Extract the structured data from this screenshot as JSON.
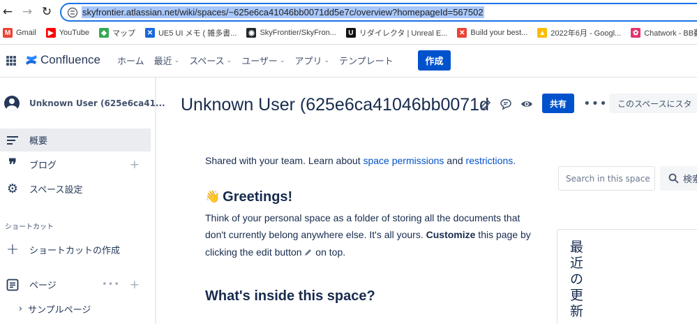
{
  "browser": {
    "url": "skyfrontier.atlassian.net/wiki/spaces/~625e6ca41046bb0071dd5e7c/overview?homepageId=567502",
    "bookmarks": [
      {
        "label": "Gmail",
        "icon": "gmail-icon",
        "color": "#ea4335",
        "glyph": "M"
      },
      {
        "label": "YouTube",
        "icon": "youtube-icon",
        "color": "#ff0000",
        "glyph": "▶"
      },
      {
        "label": "マップ",
        "icon": "maps-icon",
        "color": "#34a853",
        "glyph": "◆"
      },
      {
        "label": "UE5 UI メモ ( 雑多書...",
        "icon": "confluence-bookmark-icon",
        "color": "#1868db",
        "glyph": "✕"
      },
      {
        "label": "SkyFrontier/SkyFron...",
        "icon": "github-icon",
        "color": "#24292e",
        "glyph": "◉"
      },
      {
        "label": "リダイレクタ | Unreal E...",
        "icon": "unreal-icon",
        "color": "#111111",
        "glyph": "U"
      },
      {
        "label": "Build your best...",
        "icon": "gmail-icon",
        "color": "#ea4335",
        "glyph": "✕"
      },
      {
        "label": "2022年6月 - Googl...",
        "icon": "google-drive-icon",
        "color": "#fbbc04",
        "glyph": "▲"
      },
      {
        "label": "Chatwork - BB勤怠...",
        "icon": "chatwork-icon",
        "color": "#e3336c",
        "glyph": "✿"
      }
    ]
  },
  "topnav": {
    "logo": "Confluence",
    "menu": [
      {
        "label": "ホーム",
        "dropdown": false
      },
      {
        "label": "最近",
        "dropdown": true
      },
      {
        "label": "スペース",
        "dropdown": true
      },
      {
        "label": "ユーザー",
        "dropdown": true
      },
      {
        "label": "アプリ",
        "dropdown": true
      },
      {
        "label": "テンプレート",
        "dropdown": false
      }
    ],
    "create": "作成"
  },
  "sidebar": {
    "space_name": "Unknown User (625e6ca41...",
    "items": [
      {
        "label": "概要"
      },
      {
        "label": "ブログ"
      },
      {
        "label": "スペース設定"
      }
    ],
    "shortcut_section": "ショートカット",
    "create_shortcut": "ショートカットの作成",
    "pages": "ページ",
    "sample_page": "サンプルページ"
  },
  "page": {
    "title": "Unknown User (625e6ca41046bb0071d",
    "share": "共有",
    "more": "•••",
    "space_search_button": "このスペースにスタ",
    "intro_prefix": "Shared with your team. Learn about ",
    "intro_link1": "space permissions",
    "intro_and": " and ",
    "intro_link2": "restrictions",
    "intro_suffix": ".",
    "greeting_title": "Greetings!",
    "greeting_body_1": "Think of your personal space as a folder of storing all the documents that don't currently belong anywhere else. It's all yours. ",
    "greeting_bold": "Customize",
    "greeting_body_2": " this page by clicking the edit button ",
    "greeting_body_3": " on top.",
    "inside_title": "What's inside this space?"
  },
  "right": {
    "search_placeholder": "Search in this space",
    "search_button": "検索",
    "recent_title": "最近の更新"
  }
}
